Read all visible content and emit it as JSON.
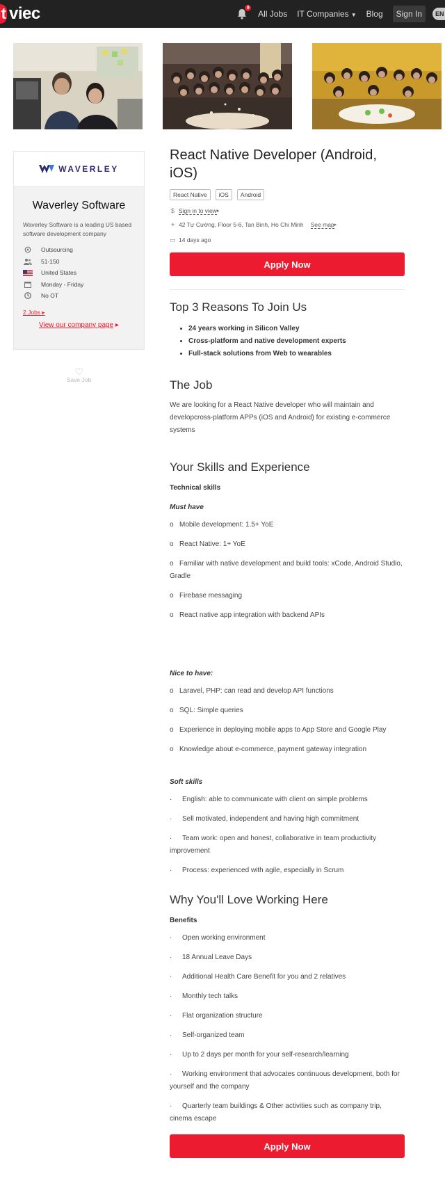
{
  "brand": {
    "it": "it",
    "viec": "viec"
  },
  "nav": {
    "notification_count": "9",
    "all_jobs": "All Jobs",
    "it_companies": "IT Companies",
    "blog": "Blog",
    "sign_in": "Sign In",
    "language": "EN"
  },
  "company": {
    "logo_text": "WAVERLEY",
    "name": "Waverley Software",
    "description": "Waverley Software is a leading US based software development company",
    "facts": [
      {
        "icon": "gear-icon",
        "text": "Outsourcing"
      },
      {
        "icon": "users-icon",
        "text": "51-150"
      },
      {
        "icon": "us-flag-icon",
        "text": "United States"
      },
      {
        "icon": "calendar-icon",
        "text": "Monday - Friday"
      },
      {
        "icon": "clock-icon",
        "text": "No OT"
      }
    ],
    "jobs_link": "2 Jobs",
    "view_page": "View our company page",
    "save_job": "Save Job"
  },
  "job": {
    "title": "React Native Developer (Android, iOS)",
    "tags": [
      "React Native",
      "iOS",
      "Android"
    ],
    "salary_prompt": "Sign in to view",
    "address": "42 Tự Cường, Floor 5-6, Tan Binh, Ho Chi Minh",
    "see_map": "See map",
    "posted": "14 days ago",
    "apply_label": "Apply Now"
  },
  "reasons": {
    "heading": "Top 3 Reasons To Join Us",
    "items": [
      "24 years working in Silicon Valley",
      "Cross-platform and native development experts",
      "Full-stack solutions from Web to wearables"
    ]
  },
  "the_job": {
    "heading": "The Job",
    "text": "We are looking for a React Native developer who will maintain and developcross-platform APPs (iOS and Android) for existing e-commerce systems"
  },
  "skills": {
    "heading": "Your Skills and Experience",
    "technical_label": "Technical skills",
    "must_have_label": "Must have",
    "must_have": [
      "Mobile development: 1.5+ YoE",
      "React Native: 1+ YoE",
      "Familiar with native development and build tools: xCode, Android Studio, Gradle",
      "Firebase messaging",
      "React native app integration with backend APIs"
    ],
    "nice_label": "Nice to have:",
    "nice_to_have": [
      "Laravel, PHP: can read and develop API functions",
      "SQL: Simple queries",
      "Experience in deploying mobile apps to App Store and Google Play",
      "Knowledge about e-commerce, payment gateway integration"
    ],
    "soft_label": "Soft skills",
    "soft": [
      "English: able to communicate with client on simple problems",
      "Sell motivated, independent and having high commitment",
      "Team work: open and honest, collaborative in team productivity improvement",
      "Process: experienced with agile, especially in Scrum"
    ],
    "bullet_o": "o",
    "bullet_dot": "·"
  },
  "love": {
    "heading": "Why You'll Love Working Here",
    "benefits_label": "Benefits",
    "benefits": [
      "Open working environment",
      "18 Annual Leave Days",
      "Additional Health Care Benefit for you and 2 relatives",
      "Monthly tech talks",
      "Flat organization structure",
      "Self-organized team",
      "Up to 2 days per month for your self-research/learning",
      "Working environment that advocates continuous development, both for yourself and the company",
      "Quarterly team buildings & Other activities such as company trip, cinema escape"
    ]
  },
  "colors": {
    "brand_red": "#ed1b2f",
    "topbar": "#222222",
    "card_bg": "#f2f2f2"
  }
}
